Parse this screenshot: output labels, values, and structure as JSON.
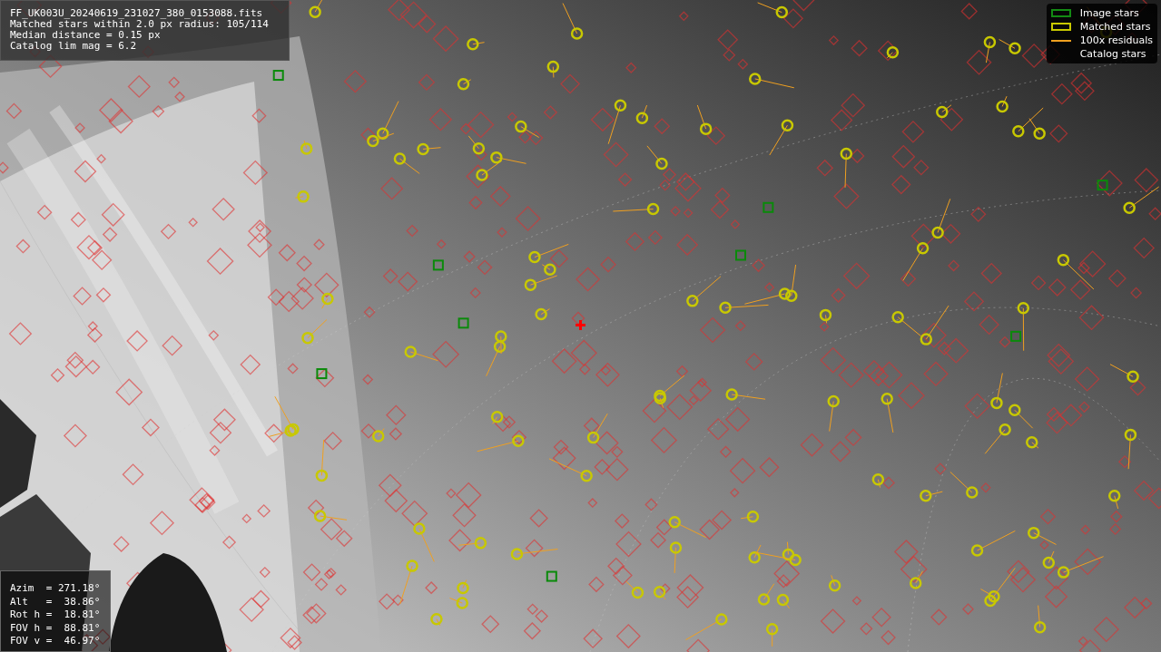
{
  "header": {
    "lines": [
      "FF_UK003U_20240619_231027_380_0153088.fits",
      "Matched stars within 2.0 px radius: 105/114",
      "Median distance = 0.15 px",
      "Catalog lim mag = 6.2"
    ]
  },
  "legend": {
    "items": [
      {
        "label": "Image stars"
      },
      {
        "kind": "matched",
        "label": "Matched stars"
      },
      {
        "kind": "residual",
        "label": "100x residuals"
      },
      {
        "kind": "catalog",
        "label": "Catalog stars"
      }
    ]
  },
  "pointing": {
    "lines": [
      "Azim  = 271.18°",
      "Alt   =  38.86°",
      "Rot h =  18.81°",
      "FOV h =  88.81°",
      "FOV v =  46.97°"
    ]
  }
}
